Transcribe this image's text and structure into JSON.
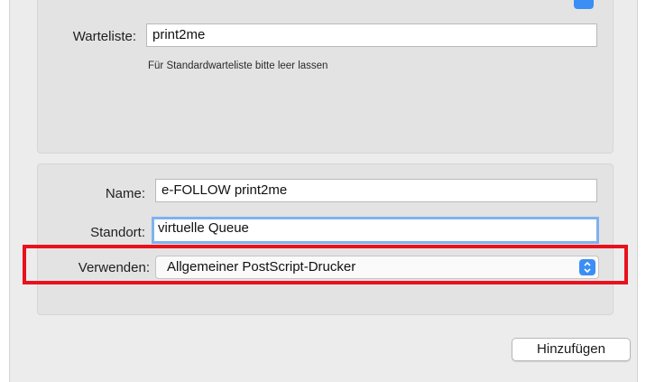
{
  "queue_section": {
    "label": "Warteliste:",
    "value": "print2me",
    "hint": "Für Standardwarteliste bitte leer lassen"
  },
  "printer_section": {
    "name": {
      "label": "Name:",
      "value": "e-FOLLOW print2me"
    },
    "location": {
      "label": "Standort:",
      "value": "virtuelle Queue"
    },
    "use": {
      "label": "Verwenden:",
      "selected": "Allgemeiner PostScript-Drucker"
    }
  },
  "actions": {
    "add_label": "Hinzufügen"
  },
  "colors": {
    "accent": "#3b8ef5",
    "focus_ring": "#7fb2ee",
    "highlight_box": "#e8111d"
  },
  "icons": {
    "select_stepper": "chevron-up-down-icon"
  }
}
